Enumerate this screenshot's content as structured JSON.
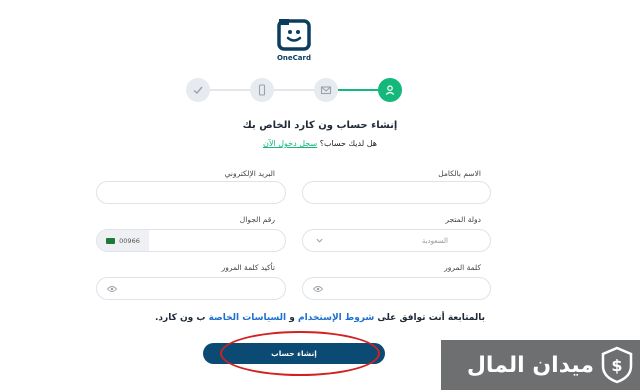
{
  "brand": {
    "name": "OneCard",
    "color": "#0b3d5e",
    "accent": "#14b87a"
  },
  "stepper": {
    "steps": [
      {
        "icon": "check-icon",
        "state": "inactive"
      },
      {
        "icon": "phone-icon",
        "state": "inactive"
      },
      {
        "icon": "envelope-icon",
        "state": "inactive"
      },
      {
        "icon": "user-icon",
        "state": "active"
      }
    ]
  },
  "form": {
    "title": "إنشاء حساب ون كارد الخاص بك",
    "have_account": "هل لديك حساب؟",
    "login_link": "سجل دخول الآن",
    "full_name_label": "الاسم بالكامل",
    "email_label": "البريد الإلكتروني",
    "store_country_label": "دولة المتجر",
    "store_country_value": "السعودية",
    "phone_label": "رقم الجوال",
    "phone_prefix": "00966",
    "password_label": "كلمة المرور",
    "confirm_password_label": "تأكيد كلمة المرور",
    "terms_prefix": "بالمتابعة أنت توافق على",
    "terms_link": "شروط الإستخدام",
    "terms_and": "و",
    "privacy_link": "السياسات الخاصة",
    "terms_suffix": "ب ون كارد.",
    "submit_label": "إنشاء حساب"
  },
  "watermark": {
    "text": "ميدان المال"
  }
}
